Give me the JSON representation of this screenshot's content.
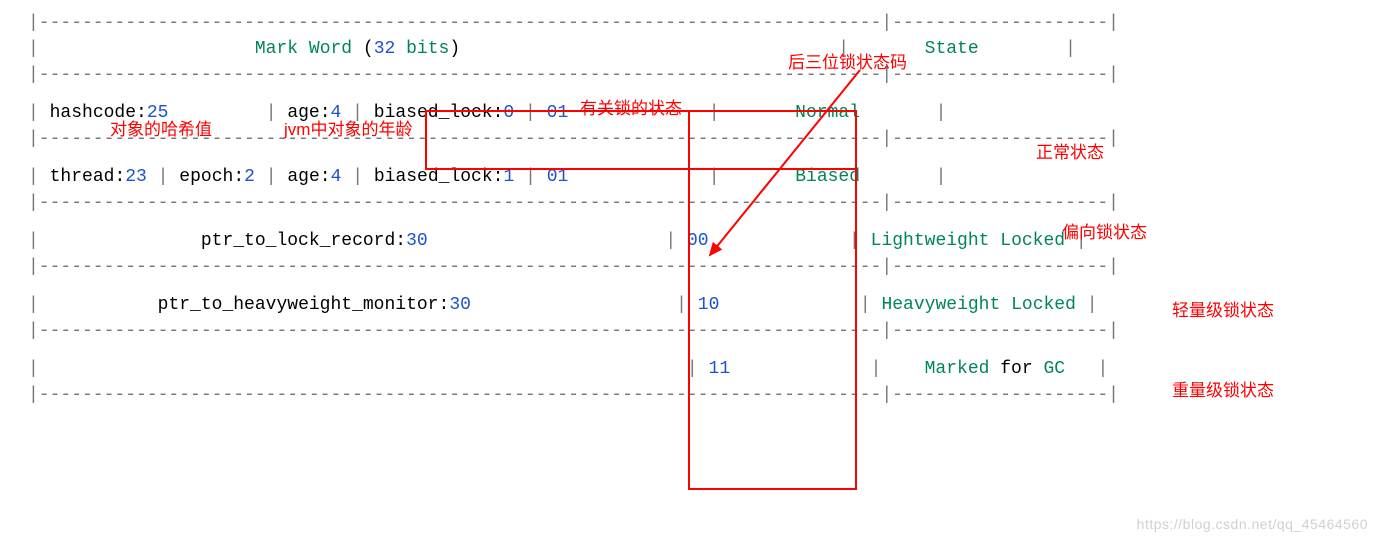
{
  "header": {
    "mark_word_label_1": "Mark",
    "mark_word_label_2": "Word",
    "paren_open": " (",
    "bits_count": "32",
    "bits_word": " bits",
    "paren_close": ")",
    "state_label": "State"
  },
  "rows": {
    "normal": {
      "hashcode_key": "hashcode",
      "hashcode_val": "25",
      "age_key": "age",
      "age_val": "4",
      "biased_lock_key": "biased_lock",
      "biased_lock_val": "0",
      "lock_bits": "01",
      "state": "Normal"
    },
    "biased": {
      "thread_key": "thread",
      "thread_val": "23",
      "epoch_key": "epoch",
      "epoch_val": "2",
      "age_key": "age",
      "age_val": "4",
      "biased_lock_key": "biased_lock",
      "biased_lock_val": "1",
      "lock_bits": "01",
      "state": "Biased"
    },
    "lightweight": {
      "ptr_key": "ptr_to_lock_record",
      "ptr_val": "30",
      "lock_bits": "00",
      "state_1": "Lightweight",
      "state_2": "Locked"
    },
    "heavyweight": {
      "ptr_key": "ptr_to_heavyweight_monitor",
      "ptr_val": "30",
      "lock_bits": "10",
      "state_1": "Heavyweight",
      "state_2": "Locked"
    },
    "gc": {
      "lock_bits": "11",
      "state_1": "Marked",
      "state_mid": " for ",
      "state_2": "GC"
    }
  },
  "annotations": {
    "hashcode": "对象的哈希值",
    "age": "jvm中对象的年龄",
    "lock_col_header": "有关锁的状态",
    "three_bit": "后三位锁状态码",
    "normal_state": "正常状态",
    "biased_state": "偏向锁状态",
    "lightweight_state": "轻量级锁状态",
    "heavyweight_state": "重量级锁状态"
  },
  "watermark": "https://blog.csdn.net/qq_45464560"
}
